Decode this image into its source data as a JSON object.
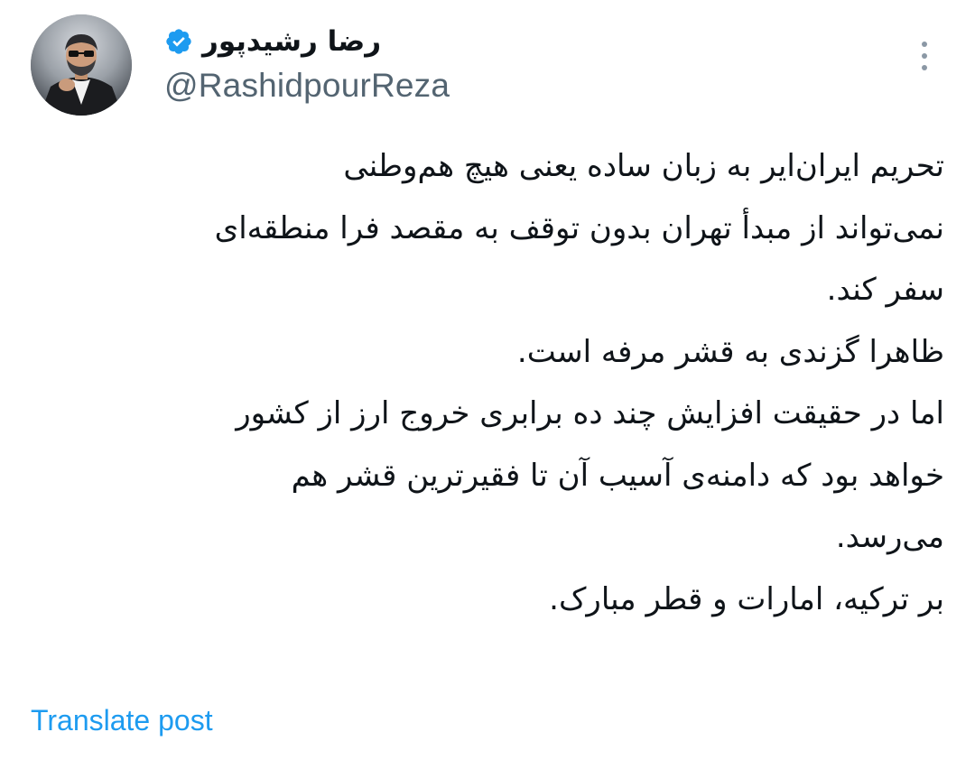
{
  "author": {
    "display_name": "رضا رشیدپور",
    "handle": "@RashidpourReza",
    "verified": true,
    "avatar_icon": "profile-photo"
  },
  "menu": {
    "icon": "more-vertical-icon"
  },
  "tweet": {
    "lines": [
      "تحریم ایران‌ایر به زبان ساده یعنی هیچ هم‌وطنی",
      "نمی‌تواند از مبدأ تهران بدون توقف به مقصد فرا منطقه‌ای",
      "سفر کند.",
      "ظاهرا گزندی به قشر مرفه است.",
      "اما در حقیقت افزایش چند ده برابری خروج ارز از کشور",
      "خواهد بود که دامنه‌ی آسیب آن تا فقیرترین قشر هم",
      "می‌رسد.",
      "بر ترکیه، امارات و قطر مبارک."
    ]
  },
  "translate_label": "Translate post",
  "colors": {
    "link": "#1d9bf0",
    "secondary_text": "#536471",
    "verified": "#1d9bf0",
    "text": "#0f1419"
  }
}
